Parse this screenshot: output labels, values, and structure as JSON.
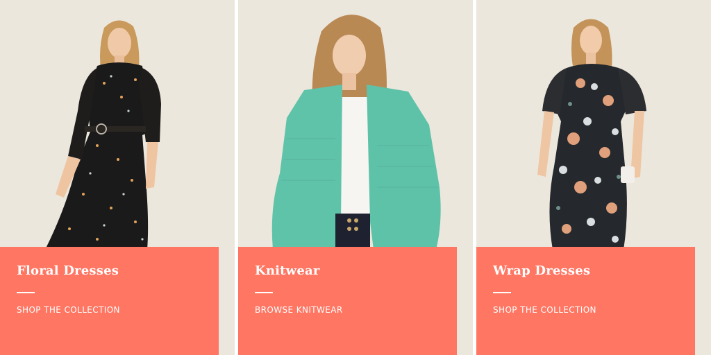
{
  "cards": [
    {
      "title": "Floral Dresses",
      "cta": "SHOP THE COLLECTION",
      "image": "model-in-black-floral-midi-dress"
    },
    {
      "title": "Knitwear",
      "cta": "BROWSE KNITWEAR",
      "image": "model-in-green-cardigan"
    },
    {
      "title": "Wrap Dresses",
      "cta": "SHOP THE COLLECTION",
      "image": "model-in-floral-wrap-dress"
    }
  ],
  "colors": {
    "panel": "#ff7663",
    "background": "#ece7dc",
    "text": "#ffffff"
  }
}
